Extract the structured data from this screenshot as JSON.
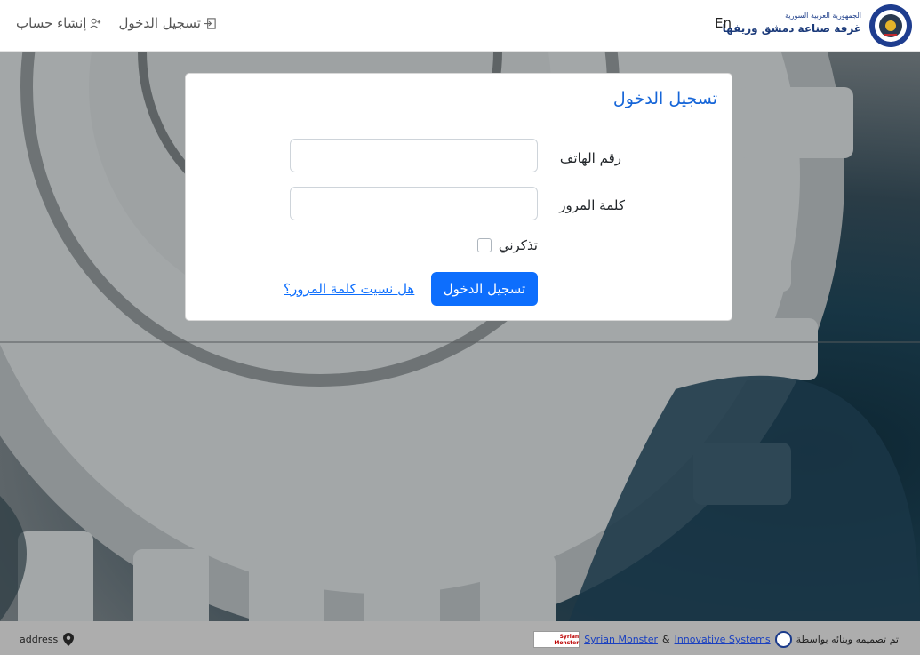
{
  "header": {
    "brand_small": "الجمهورية العربية السورية",
    "brand_big": "غرفة صناعة دمشق وريفها",
    "lang_toggle": "En",
    "nav": {
      "login": "تسجيل الدخول",
      "register": "إنشاء حساب"
    }
  },
  "login_card": {
    "title": "تسجيل الدخول",
    "phone_label": "رقم الهاتف",
    "phone_value": "",
    "password_label": "كلمة المرور",
    "password_value": "",
    "remember_label": "تذكرني",
    "remember_checked": false,
    "submit_label": "تسجيل الدخول",
    "forgot_link": "هل نسيت كلمة المرور؟"
  },
  "footer": {
    "address": "address",
    "credits_prefix": "تم تصميمه وبنائه بواسطة",
    "innovative": "Innovative Systems",
    "separator": "&",
    "syrian_monster": "Syrian Monster",
    "sm_logo_text": "Syrian Monster"
  },
  "colors": {
    "primary": "#0d6efd",
    "title_blue": "#1565d8",
    "footer_bg": "#adadad"
  },
  "icons": {
    "login_nav": "login-icon",
    "register_nav": "user-plus-icon",
    "address": "map-pin-icon"
  }
}
